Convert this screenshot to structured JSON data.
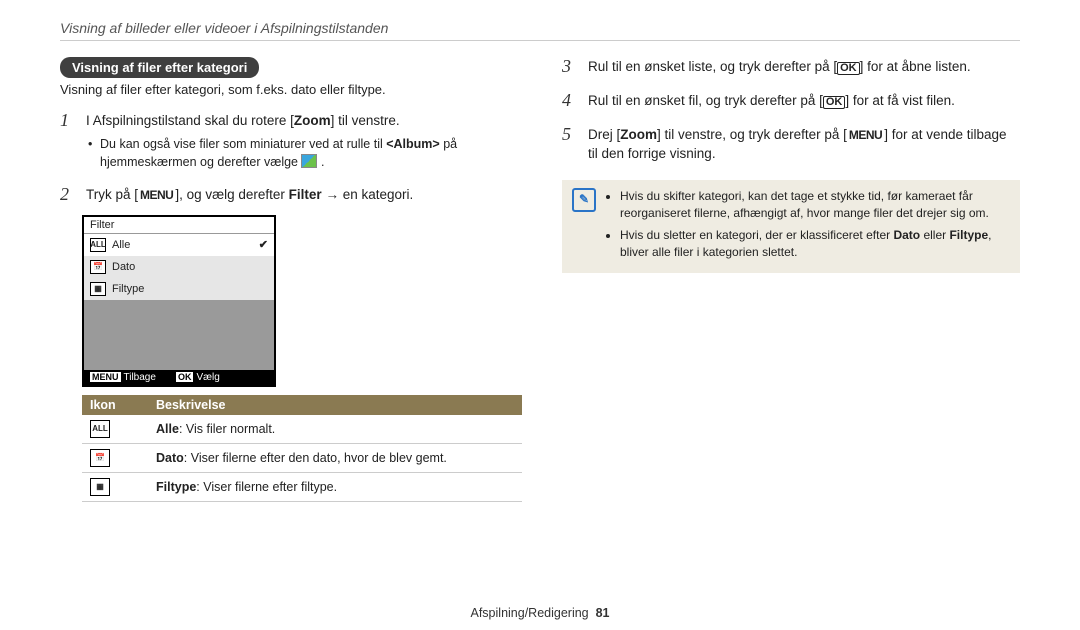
{
  "breadcrumb": "Visning af billeder eller videoer i Afspilningstilstanden",
  "left": {
    "pill": "Visning af filer efter kategori",
    "pill_sub": "Visning af filer efter kategori, som f.eks. dato eller filtype.",
    "step1": "I Afspilningstilstand skal du rotere [",
    "step1_zoom": "Zoom",
    "step1_end": "] til venstre.",
    "step1_bullet_a": "Du kan også vise filer som miniaturer ved at rulle til ",
    "step1_bullet_album": "<Album>",
    "step1_bullet_b": " på hjemmeskærmen og derefter vælge ",
    "step2_a": "Tryk på [",
    "step2_b": "], og vælg derefter ",
    "step2_filter": "Filter",
    "step2_c": " → en kategori.",
    "camera": {
      "title": "Filter",
      "items": [
        {
          "icon": "ALL",
          "label": "Alle",
          "selected": true
        },
        {
          "icon": "📅",
          "label": "Dato",
          "selected": false
        },
        {
          "icon": "▦",
          "label": "Filtype",
          "selected": false
        }
      ],
      "footer_back_tag": "MENU",
      "footer_back": "Tilbage",
      "footer_sel_tag": "OK",
      "footer_sel": "Vælg"
    },
    "table": {
      "h_icon": "Ikon",
      "h_desc": "Beskrivelse",
      "rows": [
        {
          "icon": "ALL",
          "term": "Alle",
          "rest": ": Vis filer normalt."
        },
        {
          "icon": "📅",
          "term": "Dato",
          "rest": ": Viser filerne efter den dato, hvor de blev gemt."
        },
        {
          "icon": "▦",
          "term": "Filtype",
          "rest": ": Viser filerne efter filtype."
        }
      ]
    }
  },
  "right": {
    "step3_a": "Rul til en ønsket liste, og tryk derefter på [",
    "step3_b": "] for at åbne listen.",
    "step4_a": "Rul til en ønsket fil, og tryk derefter på [",
    "step4_b": "] for at få vist filen.",
    "step5_a": "Drej [",
    "step5_zoom": "Zoom",
    "step5_b": "] til venstre, og tryk derefter på [",
    "step5_c": "] for at vende tilbage til den forrige visning.",
    "note1": "Hvis du skifter kategori, kan det tage et stykke tid, før kameraet får reorganiseret filerne, afhængigt af, hvor mange filer det drejer sig om.",
    "note2_a": "Hvis du sletter en kategori, der er klassificeret efter ",
    "note2_dato": "Dato",
    "note2_or": " eller ",
    "note2_filtype": "Filtype",
    "note2_b": ", bliver alle filer i kategorien slettet."
  },
  "footer_section": "Afspilning/Redigering",
  "page_number": "81"
}
